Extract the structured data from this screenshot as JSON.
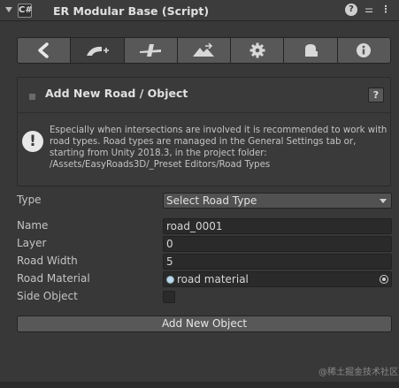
{
  "header": {
    "title": "ER Modular Base (Script)",
    "component_icon_glyph": "C#",
    "help_glyph": "?",
    "preset_glyph": "⚌",
    "more_glyph": "⋮"
  },
  "toolbar": {
    "buttons": [
      {
        "icon": "back-arrow-icon",
        "active": false
      },
      {
        "icon": "add-road-icon",
        "active": true
      },
      {
        "icon": "intersection-icon",
        "active": false
      },
      {
        "icon": "terrain-icon",
        "active": false
      },
      {
        "icon": "gear-icon",
        "active": false
      },
      {
        "icon": "side-object-icon",
        "active": false
      },
      {
        "icon": "info-icon",
        "active": false
      }
    ]
  },
  "panel": {
    "title": "Add New Road / Object",
    "help_label": "?",
    "info_glyph": "!",
    "info_text": "Especially when intersections are involved it is recommended to work with road types. Road types are managed in the General Settings tab or, starting from Unity 2018.3, in the project folder: /Assets/EasyRoads3D/_Preset Editors/Road Types"
  },
  "form": {
    "type_label": "Type",
    "type_value": "Select Road Type",
    "name_label": "Name",
    "name_value": "road_0001",
    "layer_label": "Layer",
    "layer_value": "0",
    "road_width_label": "Road Width",
    "road_width_value": "5",
    "road_material_label": "Road Material",
    "road_material_value": "road material",
    "side_object_label": "Side Object",
    "side_object_checked": false
  },
  "actions": {
    "add_button_label": "Add New Object"
  },
  "watermark": "@稀土掘金技术社区",
  "colors": {
    "background": "#383838",
    "field": "#2a2a2a",
    "button": "#585858",
    "active_tab": "#3e3e3e"
  }
}
